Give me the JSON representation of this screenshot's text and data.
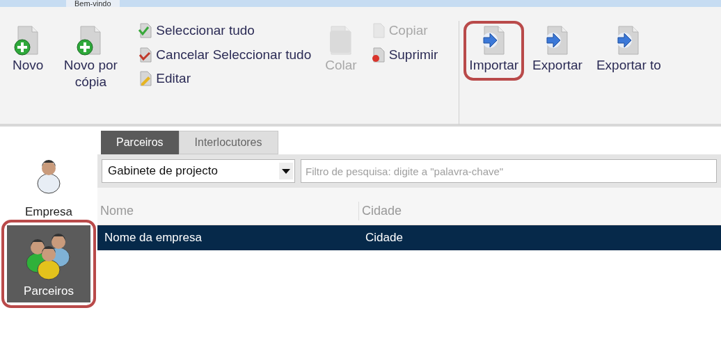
{
  "top_tabs": [
    {
      "label": "Bem-vindo",
      "selected": true
    }
  ],
  "ribbon": {
    "groups": [
      {
        "items": [
          {
            "kind": "large",
            "label": "Novo",
            "disabled": false,
            "highlighted": false
          },
          {
            "kind": "large",
            "label": "Novo por cópia",
            "disabled": false,
            "highlighted": false
          },
          {
            "kind": "stack",
            "items": [
              {
                "label": "Seleccionar tudo",
                "disabled": false
              },
              {
                "label": "Cancelar Seleccionar tudo",
                "disabled": false
              },
              {
                "label": "Editar",
                "disabled": false
              }
            ]
          },
          {
            "kind": "large",
            "label": "Colar",
            "disabled": true,
            "highlighted": false
          },
          {
            "kind": "stack",
            "items": [
              {
                "label": "Copiar",
                "disabled": true
              },
              {
                "label": "Suprimir",
                "disabled": false
              }
            ]
          }
        ]
      },
      {
        "items": [
          {
            "kind": "large",
            "label": "Importar",
            "disabled": false,
            "highlighted": true
          },
          {
            "kind": "large",
            "label": "Exportar",
            "disabled": false,
            "highlighted": false
          },
          {
            "kind": "large",
            "label": "Exportar to",
            "disabled": false,
            "highlighted": false
          }
        ]
      }
    ]
  },
  "sidebar": {
    "items": [
      {
        "label": "Empresa",
        "selected": false,
        "highlighted": false
      },
      {
        "label": "Parceiros",
        "selected": true,
        "highlighted": true
      }
    ]
  },
  "tabs": [
    {
      "label": "Parceiros",
      "selected": true
    },
    {
      "label": "Interlocutores",
      "selected": false
    }
  ],
  "filter": {
    "value": "Gabinete de projecto"
  },
  "search": {
    "placeholder": "Filtro de pesquisa: digite a \"palavra-chave\""
  },
  "table": {
    "columns": [
      "Nome",
      "Cidade"
    ],
    "rows": [
      {
        "cells": [
          "Nome da empresa",
          "Cidade"
        ],
        "selected": true
      }
    ]
  }
}
